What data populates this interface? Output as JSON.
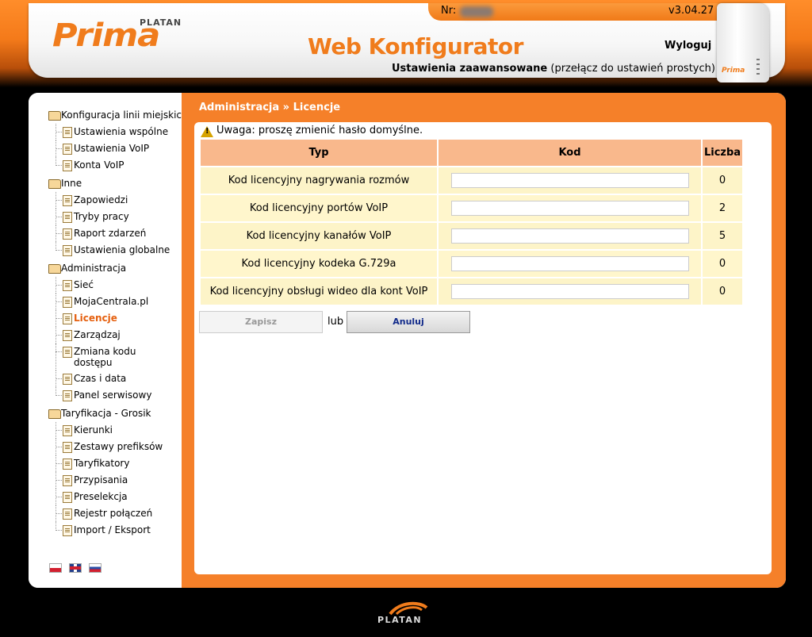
{
  "header": {
    "nr_label": "Nr:",
    "version": "v3.04.27",
    "logo_platan": "PLATAN",
    "logo_prima": "Prima",
    "app_title": "Web Konfigurator",
    "logout": "Wyloguj",
    "mode_bold": "Ustawienia zaawansowane",
    "mode_link": "(przełącz do ustawień prostych)",
    "device_logo": "Prima"
  },
  "sidebar": {
    "groups": [
      {
        "label": "Konfiguracja linii miejskich",
        "items": [
          "Ustawienia wspólne",
          "Ustawienia VoIP",
          "Konta VoIP"
        ]
      },
      {
        "label": "Inne",
        "items": [
          "Zapowiedzi",
          "Tryby pracy",
          "Raport zdarzeń",
          "Ustawienia globalne"
        ]
      },
      {
        "label": "Administracja",
        "items": [
          "Sieć",
          "MojaCentrala.pl",
          "Licencje",
          "Zarządzaj",
          "Zmiana kodu dostępu",
          "Czas i data",
          "Panel serwisowy"
        ]
      },
      {
        "label": "Taryfikacja - Grosik",
        "items": [
          "Kierunki",
          "Zestawy prefiksów",
          "Taryfikatory",
          "Przypisania",
          "Preselekcja",
          "Rejestr połączeń",
          "Import / Eksport"
        ]
      }
    ],
    "active_item": "Licencje",
    "languages": [
      "pl",
      "en",
      "ru"
    ]
  },
  "content": {
    "breadcrumb": "Administracja » Licencje",
    "warning": "Uwaga: proszę zmienić hasło domyślne.",
    "table": {
      "headers": [
        "Typ",
        "Kod",
        "Liczba"
      ],
      "rows": [
        {
          "typ": "Kod licencyjny nagrywania rozmów",
          "kod": "",
          "liczba": "0"
        },
        {
          "typ": "Kod licencyjny portów VoIP",
          "kod": "",
          "liczba": "2"
        },
        {
          "typ": "Kod licencyjny kanałów VoIP",
          "kod": "",
          "liczba": "5"
        },
        {
          "typ": "Kod licencyjny kodeka G.729a",
          "kod": "",
          "liczba": "0"
        },
        {
          "typ": "Kod licencyjny obsługi wideo dla kont VoIP",
          "kod": "",
          "liczba": "0"
        }
      ]
    },
    "save_label": "Zapisz",
    "or_label": "lub",
    "cancel_label": "Anuluj"
  },
  "footer": {
    "brand": "PLATAN"
  },
  "colors": {
    "accent_orange": "#f58029",
    "header_cell": "#f9b88c",
    "row_bg": "#fdf4c8",
    "active_link": "#e5600f",
    "cancel_text": "#112a8a"
  }
}
